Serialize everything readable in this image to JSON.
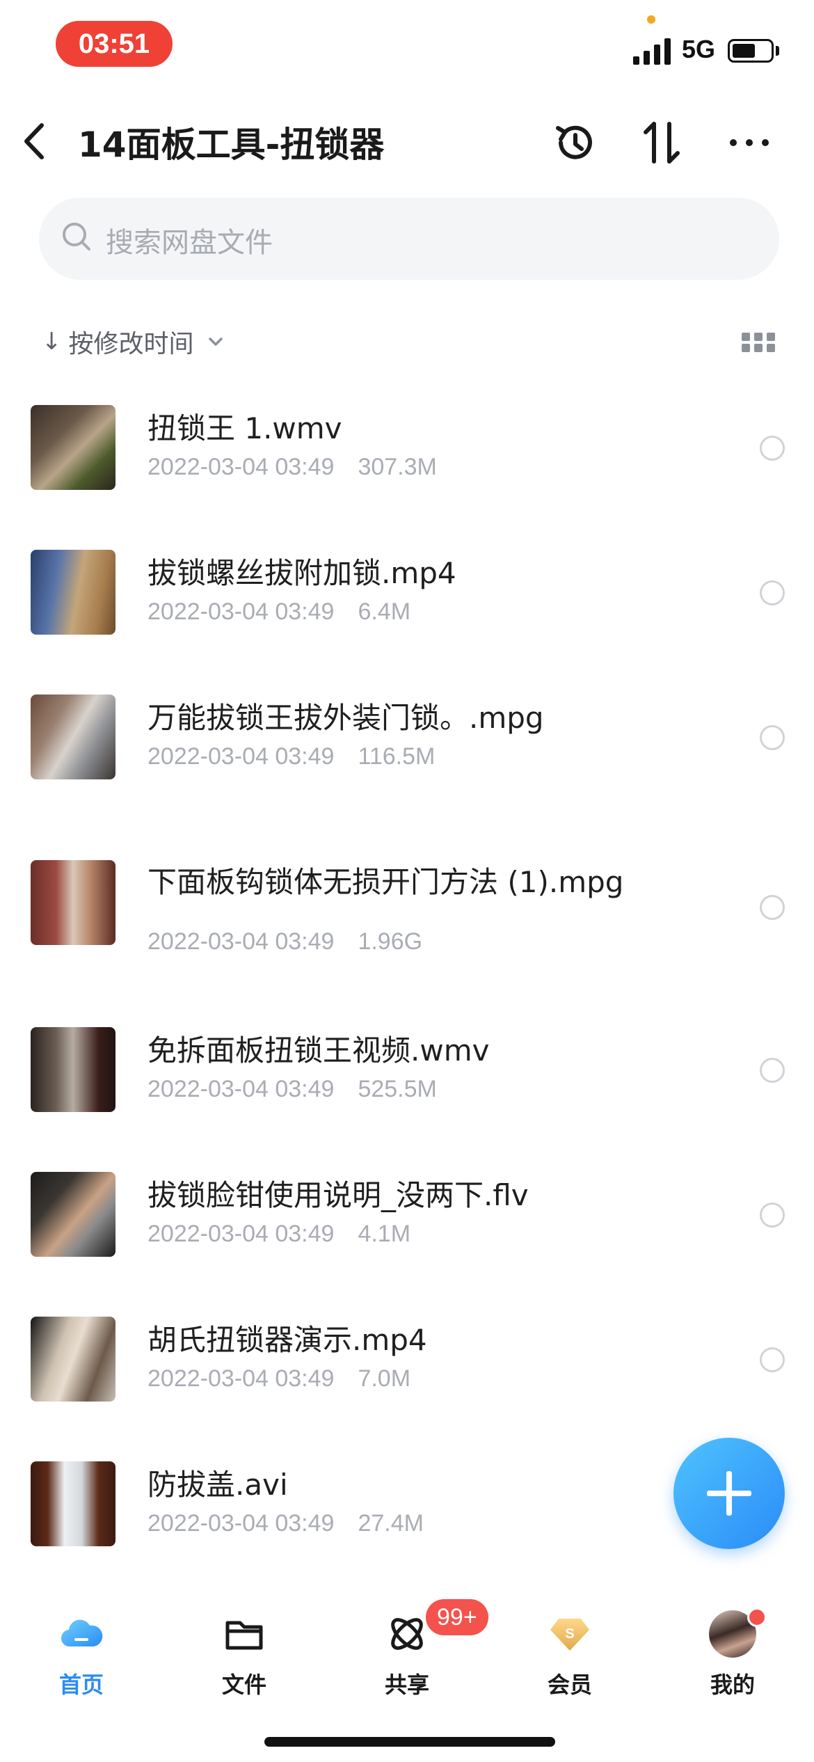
{
  "status_bar": {
    "time": "03:51",
    "network": "5G"
  },
  "header": {
    "title": "14面板工具-扭锁器"
  },
  "search": {
    "placeholder": "搜索网盘文件"
  },
  "sort": {
    "label": "按修改时间"
  },
  "files": [
    {
      "name": "扭锁王 1.wmv",
      "date": "2022-03-04 03:49",
      "size": "307.3M"
    },
    {
      "name": "拔锁螺丝拔附加锁.mp4",
      "date": "2022-03-04 03:49",
      "size": "6.4M"
    },
    {
      "name": "万能拔锁王拔外装门锁。.mpg",
      "date": "2022-03-04 03:49",
      "size": "116.5M"
    },
    {
      "name": "下面板钩锁体无损开门方法 (1).mpg",
      "date": "2022-03-04 03:49",
      "size": "1.96G"
    },
    {
      "name": "免拆面板扭锁王视频.wmv",
      "date": "2022-03-04 03:49",
      "size": "525.5M"
    },
    {
      "name": "拔锁脸钳使用说明_没两下.flv",
      "date": "2022-03-04 03:49",
      "size": "4.1M"
    },
    {
      "name": "胡氏扭锁器演示.mp4",
      "date": "2022-03-04 03:49",
      "size": "7.0M"
    },
    {
      "name": "防拔盖.avi",
      "date": "2022-03-04 03:49",
      "size": "27.4M"
    }
  ],
  "nav": {
    "home": "首页",
    "files": "文件",
    "share": "共享",
    "vip": "会员",
    "me": "我的",
    "share_badge": "99+"
  },
  "colors": {
    "accent": "#2b8cf2",
    "time_pill": "#ef4136",
    "badge": "#f4524d"
  }
}
